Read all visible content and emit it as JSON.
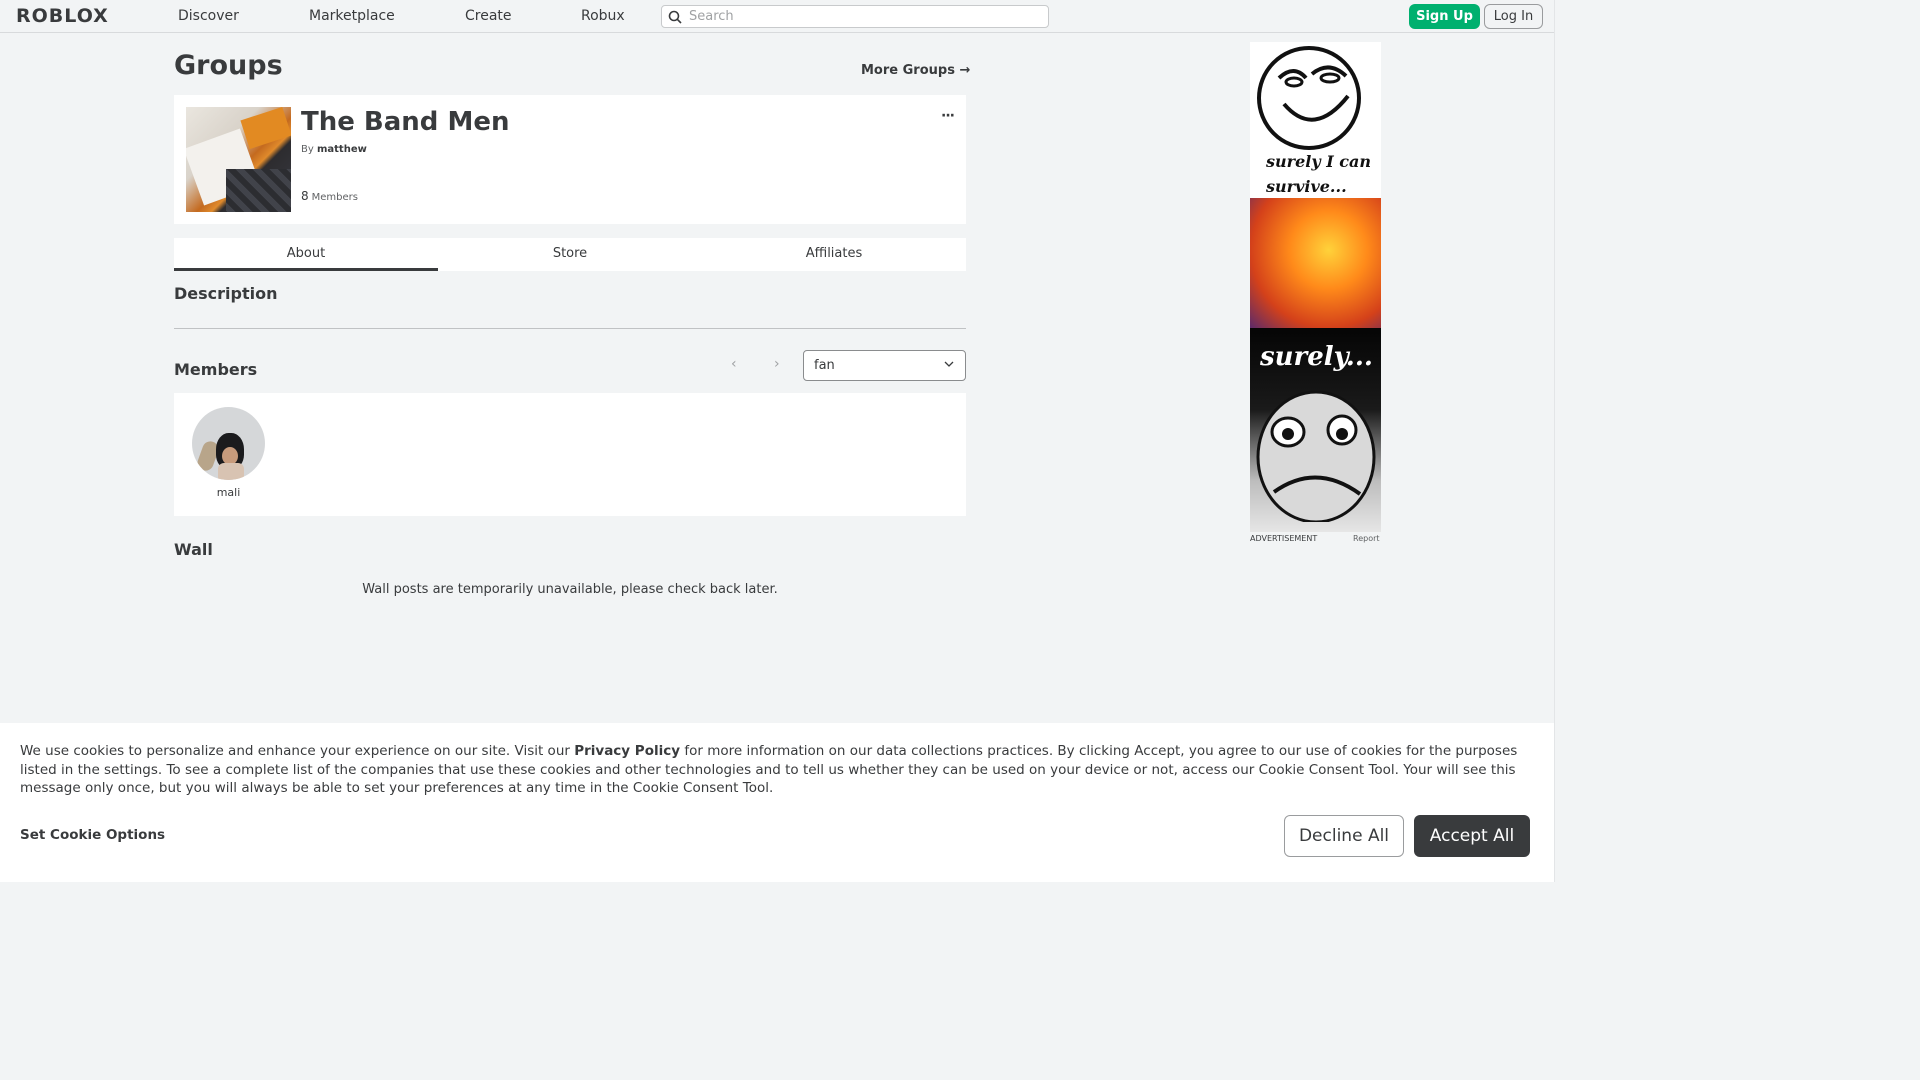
{
  "nav": {
    "logo": "ROBLOX",
    "links": [
      "Discover",
      "Marketplace",
      "Create",
      "Robux"
    ],
    "search_placeholder": "Search",
    "signup": "Sign Up",
    "login": "Log In"
  },
  "page": {
    "title": "Groups",
    "more_groups": "More Groups →"
  },
  "group": {
    "name": "The Band Men",
    "by_label": "By",
    "owner": "matthew",
    "member_count": "8",
    "members_label": "Members",
    "menu": "···"
  },
  "tabs": [
    "About",
    "Store",
    "Affiliates"
  ],
  "about": {
    "description_title": "Description",
    "members_title": "Members",
    "pager_prev": "‹",
    "pager_next": "›",
    "role_selected": "fan",
    "members": [
      {
        "name": "mali"
      }
    ],
    "wall_title": "Wall",
    "wall_message": "Wall posts are temporarily unavailable, please check back later."
  },
  "ad": {
    "text_top_1": "surely I can",
    "text_top_2": "survive...",
    "text_bottom": "surely...",
    "label": "ADVERTISEMENT",
    "report": "Report"
  },
  "cookie": {
    "text_before": "We use cookies to personalize and enhance your experience on our site. Visit our ",
    "privacy_link": "Privacy Policy",
    "text_after": " for more information on our data collections practices. By clicking Accept, you agree to our use of cookies for the purposes listed in the settings. To see a complete list of the companies that use these cookies and other technologies and to tell us whether they can be used on your device or not, access our Cookie Consent Tool. Your will see this message only once, but you will always be able to set your preferences at any time in the Cookie Consent Tool.",
    "set_options": "Set Cookie Options",
    "decline": "Decline All",
    "accept": "Accept All"
  },
  "colors": {
    "brand_green": "#00b06f",
    "dark": "#393b3d",
    "page_bg": "#f2f4f5"
  }
}
